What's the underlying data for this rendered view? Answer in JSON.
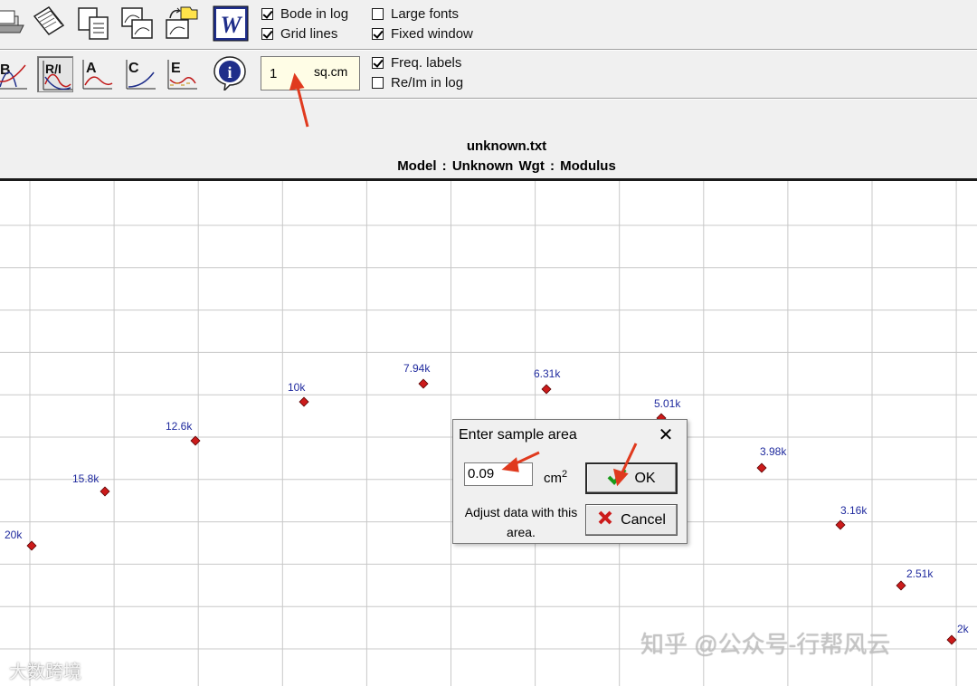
{
  "toolbar": {
    "tools_row1": [
      {
        "icon": "open-file-icon"
      },
      {
        "icon": "open-multiple-files-icon"
      },
      {
        "icon": "copy-icon"
      },
      {
        "icon": "multiple-graphs-icon"
      },
      {
        "icon": "export-folder-icon"
      },
      {
        "icon": "word-export-icon",
        "text": "W"
      }
    ],
    "tools_row2": [
      {
        "icon": "bode-plot-icon",
        "text": "B"
      },
      {
        "icon": "real-imaginary-plot-icon",
        "text": "R/I"
      },
      {
        "icon": "admittance-plot-icon",
        "text": "A"
      },
      {
        "icon": "capacitance-plot-icon",
        "text": "C"
      },
      {
        "icon": "permittivity-plot-icon",
        "text": "E"
      },
      {
        "icon": "info-icon",
        "text": "i"
      }
    ],
    "options": [
      {
        "label": "Bode in log",
        "checked": true
      },
      {
        "label": "Grid lines",
        "checked": true
      },
      {
        "label": "Large fonts",
        "checked": false
      },
      {
        "label": "Fixed window",
        "checked": true
      },
      {
        "label": "Freq. labels",
        "checked": true
      },
      {
        "label": "Re/Im in log",
        "checked": false
      }
    ],
    "area_value": "1",
    "area_unit": "sq.cm"
  },
  "chart": {
    "title": "unknown.txt",
    "subtitle": "Model : Unknown     Wgt : Modulus"
  },
  "chart_data": {
    "type": "scatter",
    "title": "unknown.txt",
    "subtitle": "Model : Unknown     Wgt : Modulus",
    "grid": true,
    "point_color": "#cc1b1b",
    "label_color": "#1f2a9e",
    "points": [
      {
        "label": "20k"
      },
      {
        "label": "15.8k"
      },
      {
        "label": "12.6k"
      },
      {
        "label": "10k"
      },
      {
        "label": "7.94k"
      },
      {
        "label": "6.31k"
      },
      {
        "label": "5.01k"
      },
      {
        "label": "3.98k"
      },
      {
        "label": "3.16k"
      },
      {
        "label": "2.51k"
      },
      {
        "label": "2k"
      }
    ]
  },
  "dialog": {
    "title": "Enter sample area",
    "close": "✕",
    "value": "0.09",
    "unit": "cm",
    "unit_sup": "2",
    "hint": "Adjust data with this area.",
    "ok_label": "OK",
    "cancel_label": "Cancel"
  },
  "watermarks": {
    "left": "大数跨境",
    "right": "知乎 @公众号-行帮风云"
  },
  "colors": {
    "toolbar_bg": "#f0f0f0",
    "grid": "#c8c8c8",
    "arrow": "#e03a1e"
  }
}
